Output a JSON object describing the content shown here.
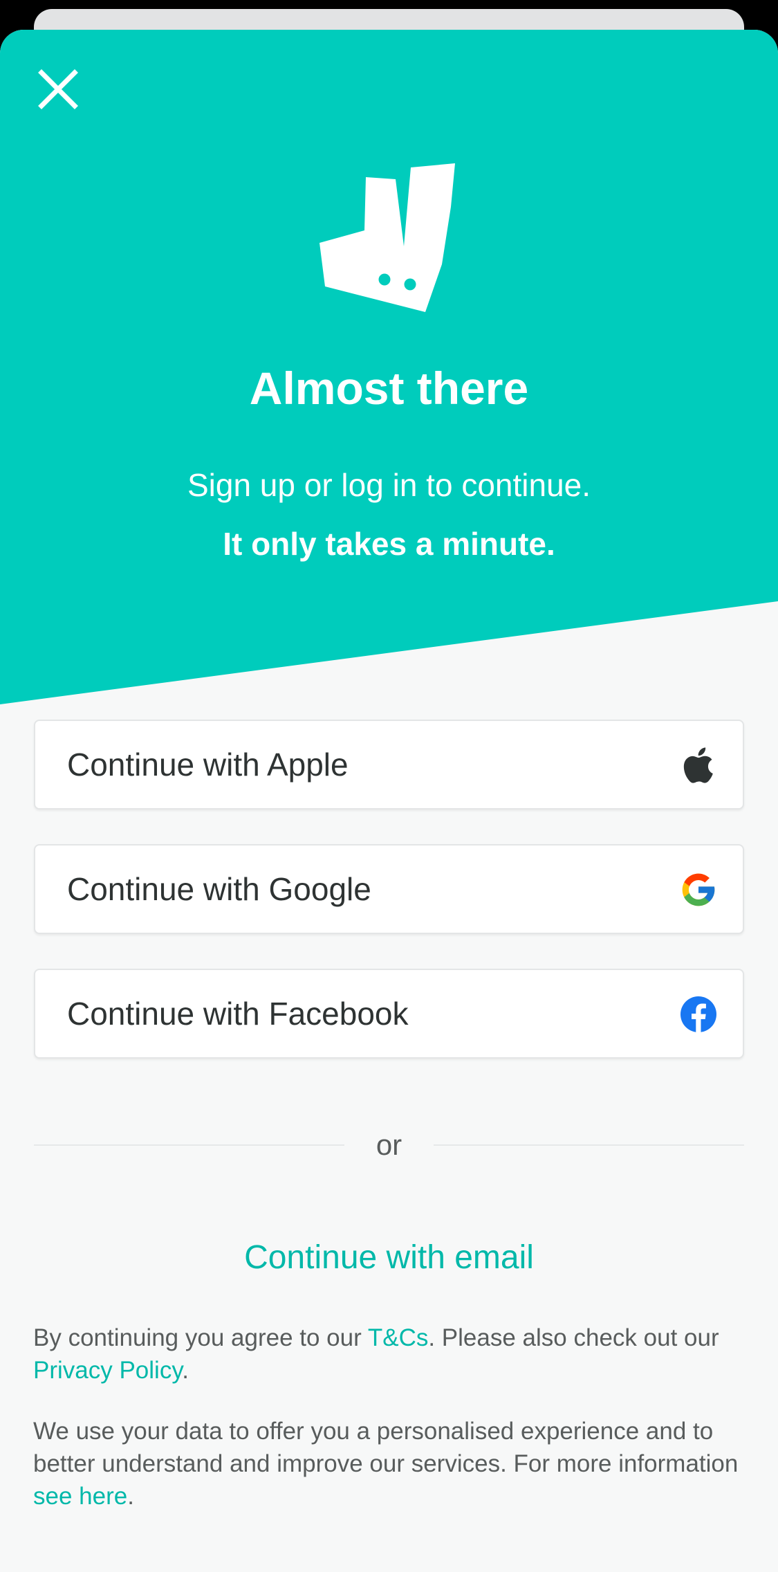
{
  "header": {
    "title": "Almost there",
    "subtitle": "Sign up or log in to continue.",
    "subtitle_emphasis": "It only takes a minute."
  },
  "icons": {
    "close": "close-icon",
    "logo": "deliveroo-logo",
    "apple": "apple-icon",
    "google": "google-icon",
    "facebook": "facebook-icon"
  },
  "auth_buttons": {
    "apple": "Continue with Apple",
    "google": "Continue with Google",
    "facebook": "Continue with Facebook"
  },
  "divider": {
    "label": "or"
  },
  "email_link": "Continue with email",
  "legal": {
    "terms_prefix": "By continuing you agree to our ",
    "terms_link": "T&Cs",
    "terms_middle": ". Please also check out our ",
    "privacy_link": "Privacy Policy",
    "terms_suffix": ".",
    "data_prefix": "We use your data to offer you a personalised experience and to better understand and improve our services. For more information ",
    "data_link": "see here",
    "data_suffix": "."
  },
  "colors": {
    "brand": "#00ccbc",
    "link": "#00b8a9",
    "background": "#f7f8f8",
    "text": "#2e3333",
    "muted_text": "#585c5c",
    "apple_icon": "#2e3333",
    "facebook_icon": "#1877f2"
  }
}
